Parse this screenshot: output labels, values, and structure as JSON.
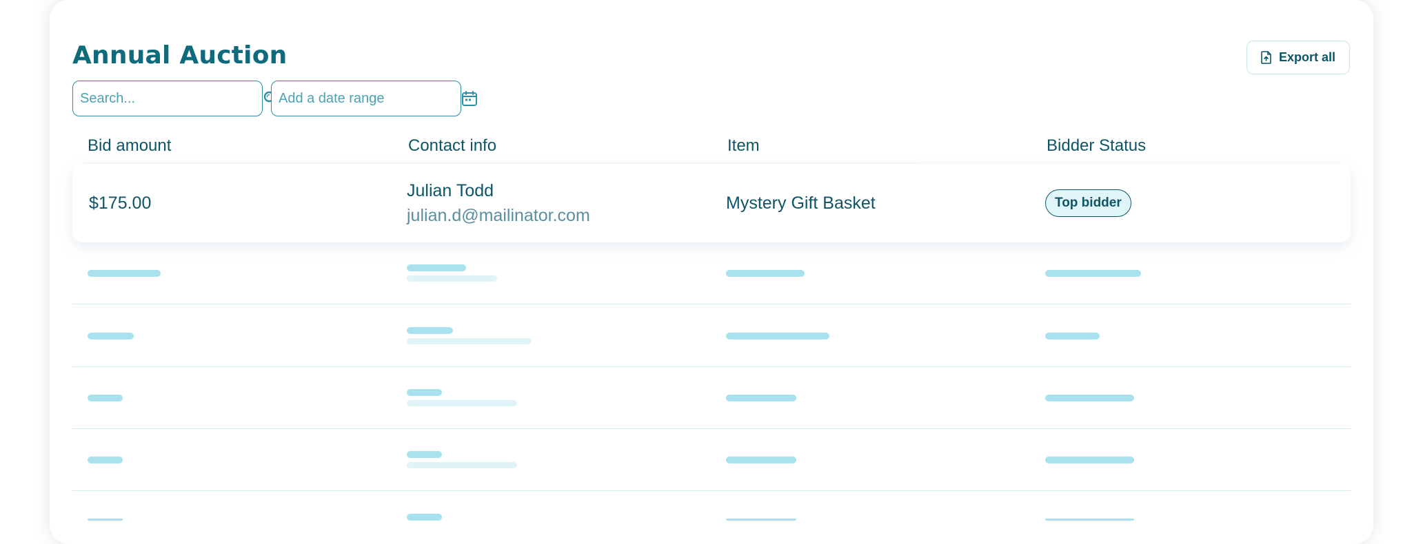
{
  "page": {
    "title": "Annual Auction",
    "export_label": "Export all"
  },
  "filters": {
    "search_placeholder": "Search...",
    "date_placeholder": "Add a date range"
  },
  "table": {
    "columns": [
      "Bid amount",
      "Contact info",
      "Item",
      "Bidder Status"
    ],
    "rows": [
      {
        "bid_amount": "$175.00",
        "contact_name": "Julian Todd",
        "contact_email": "julian.d@mailinator.com",
        "item": "Mystery Gift Basket",
        "status": "Top bidder"
      }
    ]
  },
  "icons": {
    "search": "search-icon",
    "calendar": "calendar-icon",
    "export": "file-export-icon"
  },
  "colors": {
    "primary": "#0f6a7c",
    "accent": "#2a8fa3",
    "skeleton": "#a9e2ee",
    "skeleton_light": "#e0f4f8",
    "badge_bg": "#dff5f8"
  }
}
